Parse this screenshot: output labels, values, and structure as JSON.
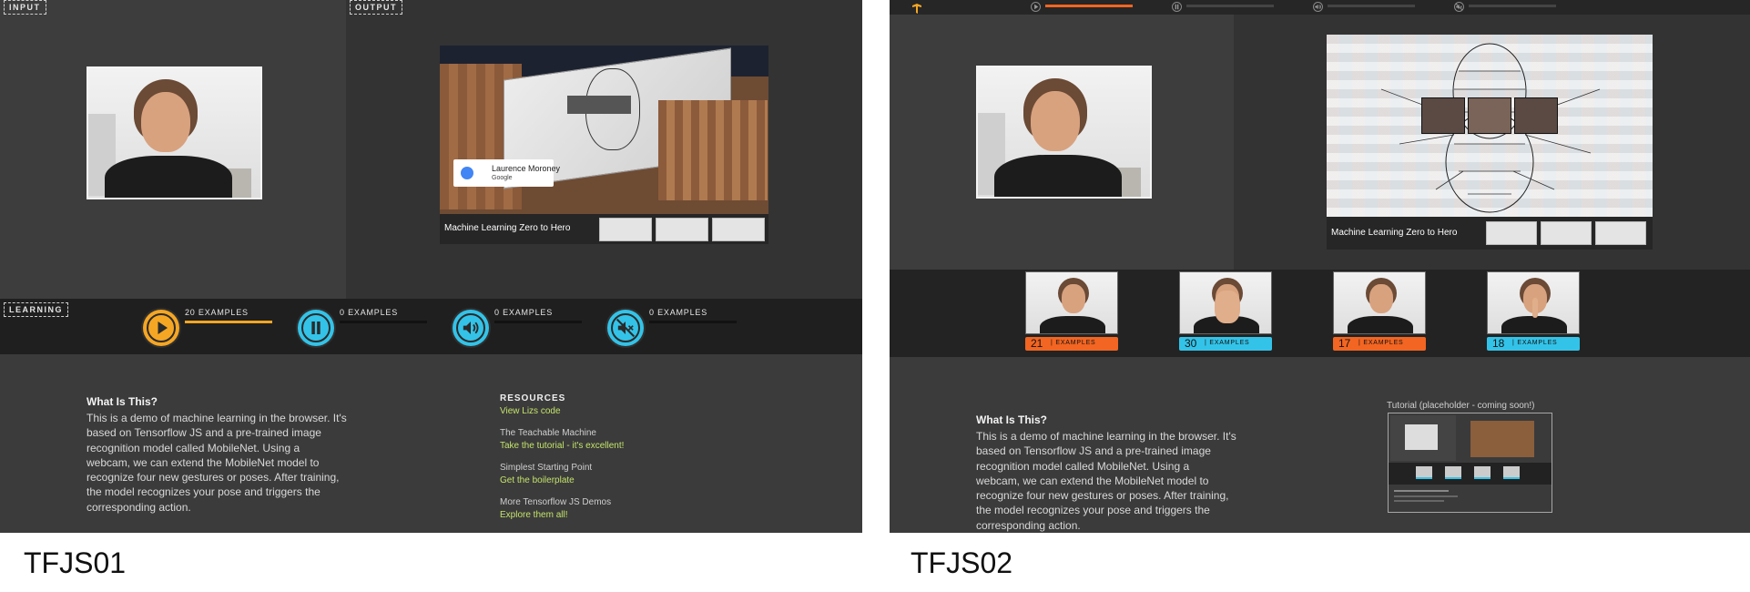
{
  "captions": [
    "TFJS01",
    "TFJS02"
  ],
  "tfjs01": {
    "input_tag": "INPUT",
    "output_tag": "OUTPUT",
    "learning_tag": "LEARNING",
    "video": {
      "speaker_name": "Laurence Moroney",
      "speaker_org": "Google",
      "title": "Machine Learning Zero to Hero"
    },
    "controls": [
      {
        "icon": "play-icon",
        "label": "20 EXAMPLES",
        "color": "#f5a623",
        "progress": 1.0
      },
      {
        "icon": "pause-icon",
        "label": "0 EXAMPLES",
        "color": "#33c3e8",
        "progress": 0
      },
      {
        "icon": "volume-icon",
        "label": "0 EXAMPLES",
        "color": "#33c3e8",
        "progress": 0
      },
      {
        "icon": "mute-icon",
        "label": "0 EXAMPLES",
        "color": "#33c3e8",
        "progress": 0
      }
    ],
    "what": {
      "heading": "What Is This?",
      "l1": "This is a demo of machine learning in the browser. It's",
      "l2": "based on Tensorflow JS and a pre-trained image",
      "l3": "recognition model called MobileNet. Using a",
      "l4": "webcam, we can extend the MobileNet model to",
      "l5": "recognize four new gestures or poses. After training,",
      "l6": "the model recognizes your pose and triggers the",
      "l7": "corresponding action."
    },
    "resources": {
      "heading": "RESOURCES",
      "view_code": "View Lizs code",
      "teachable_label": "The Teachable Machine",
      "teachable_link": "Take the tutorial - it's excellent!",
      "simplest_label": "Simplest Starting Point",
      "simplest_link": "Get the boilerplate",
      "more_label": "More Tensorflow JS Demos",
      "more_link": "Explore them all!"
    }
  },
  "tfjs02": {
    "video_title": "Machine Learning Zero to Hero",
    "top_controls": [
      {
        "icon": "play-icon",
        "progress": 1.0
      },
      {
        "icon": "pause-icon",
        "progress": 0
      },
      {
        "icon": "volume-icon",
        "progress": 0
      },
      {
        "icon": "mute-icon",
        "progress": 0
      }
    ],
    "examples": [
      {
        "count": "21",
        "label": "EXAMPLES",
        "color": "#f26522"
      },
      {
        "count": "30",
        "label": "EXAMPLES",
        "color": "#33c3e8"
      },
      {
        "count": "17",
        "label": "EXAMPLES",
        "color": "#f26522"
      },
      {
        "count": "18",
        "label": "EXAMPLES",
        "color": "#33c3e8"
      }
    ],
    "what": {
      "heading": "What Is This?",
      "l1": "This is a demo of machine learning in the browser. It's",
      "l2": "based on Tensorflow JS and a pre-trained image",
      "l3": "recognition model called MobileNet. Using a",
      "l4": "webcam, we can extend the MobileNet model to",
      "l5": "recognize four new gestures or poses. After training,",
      "l6": "the model recognizes your pose and triggers the",
      "l7": "corresponding action."
    },
    "tutorial_label": "Tutorial (placeholder - coming soon!)"
  }
}
